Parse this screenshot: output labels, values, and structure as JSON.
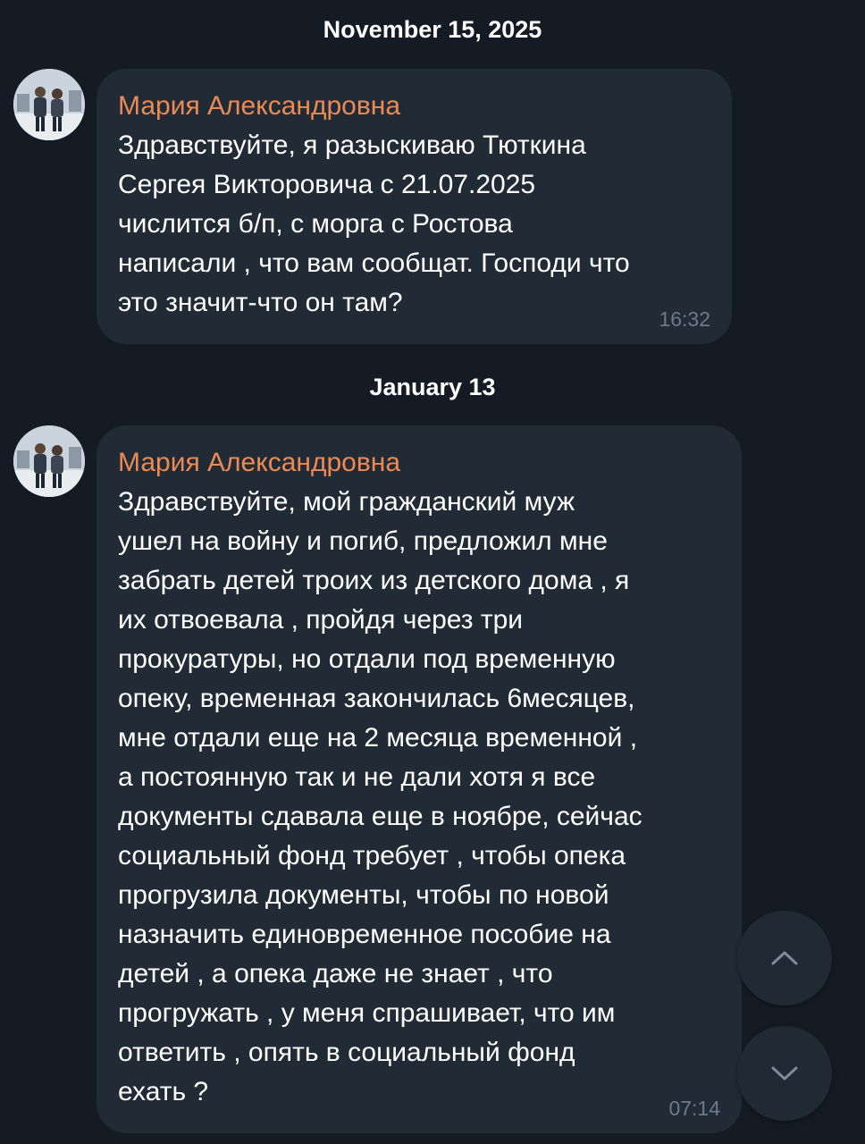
{
  "messages": [
    {
      "date": "November 15, 2025",
      "sender": "Мария Александровна",
      "text": "Здравствуйте, я разыскиваю  Тюткина\nСергея Викторовича  с 21.07.2025\nчислится б/п, с морга с Ростова\nнаписали , что вам сообщат. Господи что\nэто значит-что он там?",
      "time": "16:32",
      "avatar_icon": "profile-photo"
    },
    {
      "date": "January 13",
      "sender": "Мария Александровна",
      "text": "Здравствуйте, мой гражданский муж\nушел на войну и погиб, предложил мне\nзабрать детей троих из детского дома , я\nих отвоевала , пройдя через три\nпрокуратуры, но отдали под временную\nопеку, временная закончилась 6месяцев,\nмне отдали еще на 2 месяца временной ,\nа постоянную так и не дали хотя я все\nдокументы сдавала еще в ноябре, сейчас\nсоциальный фонд требует , чтобы опека\nпрогрузила документы, чтобы по новой\nназначить единовременное пособие на\nдетей , а опека даже не знает , что\nпрогружать , у меня спрашивает, что им\nответить , опять в социальный фонд\nехать ?",
      "time": "07:14",
      "avatar_icon": "profile-photo"
    }
  ],
  "controls": {
    "scroll_up_icon": "chevron-up-icon",
    "scroll_down_icon": "chevron-down-icon"
  },
  "colors": {
    "background": "#151b24",
    "bubble": "#202b36",
    "sender_name": "#ec8a55",
    "timestamp": "#6d7b89",
    "text": "#ffffff"
  }
}
